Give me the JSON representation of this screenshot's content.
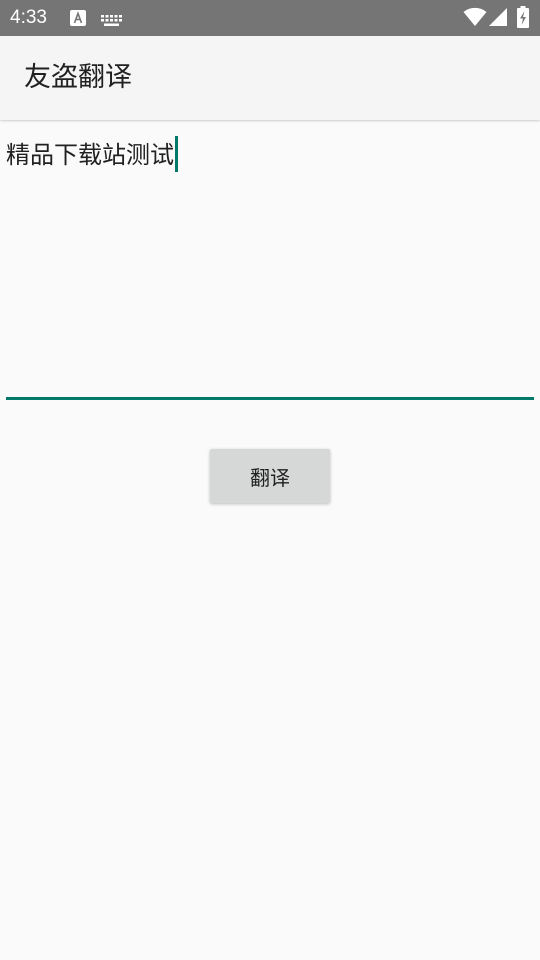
{
  "status_bar": {
    "time": "4:33",
    "icons": [
      "text-recognition-icon",
      "keyboard-icon",
      "wifi-icon",
      "cellular-signal-icon",
      "battery-charging-icon"
    ],
    "background": "#757575"
  },
  "app_bar": {
    "title": "友盗翻译"
  },
  "input": {
    "value": "精品下载站测试",
    "accent_color": "#00796b"
  },
  "translate_button": {
    "label": "翻译"
  }
}
